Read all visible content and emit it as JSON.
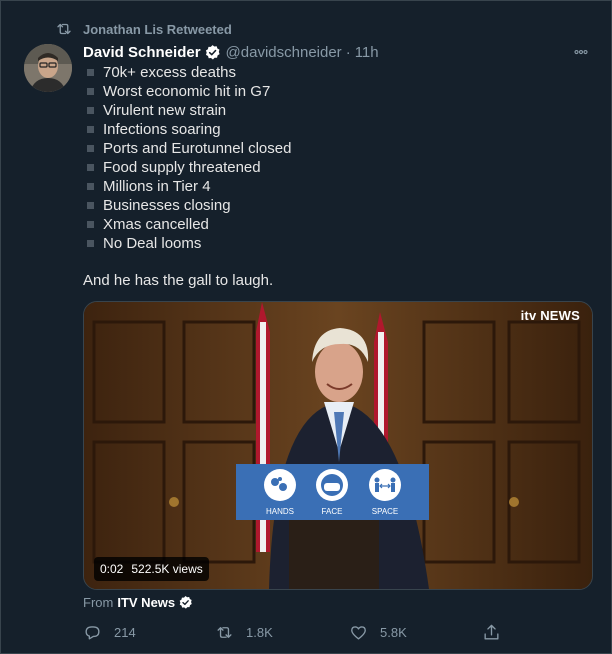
{
  "retweet": {
    "label": "Jonathan Lis Retweeted"
  },
  "tweet": {
    "author_name": "David Schneider",
    "handle": "@davidschneider",
    "separator": "·",
    "time": "11h",
    "items": [
      "70k+ excess deaths",
      "Worst economic hit in G7",
      "Virulent new strain",
      "Infections soaring",
      "Ports and Eurotunnel closed",
      "Food supply threatened",
      "Millions in Tier 4",
      "Businesses closing",
      "Xmas cancelled",
      "No Deal looms"
    ],
    "tail_text": "And he has the gall to laugh."
  },
  "media": {
    "channel_logo": "itv NEWS",
    "podium_labels": [
      "HANDS",
      "FACE",
      "SPACE"
    ],
    "video_time": "0:02",
    "views": "522.5K views"
  },
  "source": {
    "prefix": "From",
    "name": "ITV News"
  },
  "actions": {
    "replies": "214",
    "retweets": "1.8K",
    "likes": "5.8K"
  },
  "icons": {
    "retweet": "retweet-icon",
    "verified": "verified-badge-icon",
    "more": "more-icon",
    "reply": "reply-icon",
    "like": "like-icon",
    "share": "share-icon"
  },
  "colors": {
    "background": "#15202b",
    "secondary_text": "#8899a6",
    "verified_blue": "#ffffff",
    "podium_blue": "#3a6fb5"
  }
}
